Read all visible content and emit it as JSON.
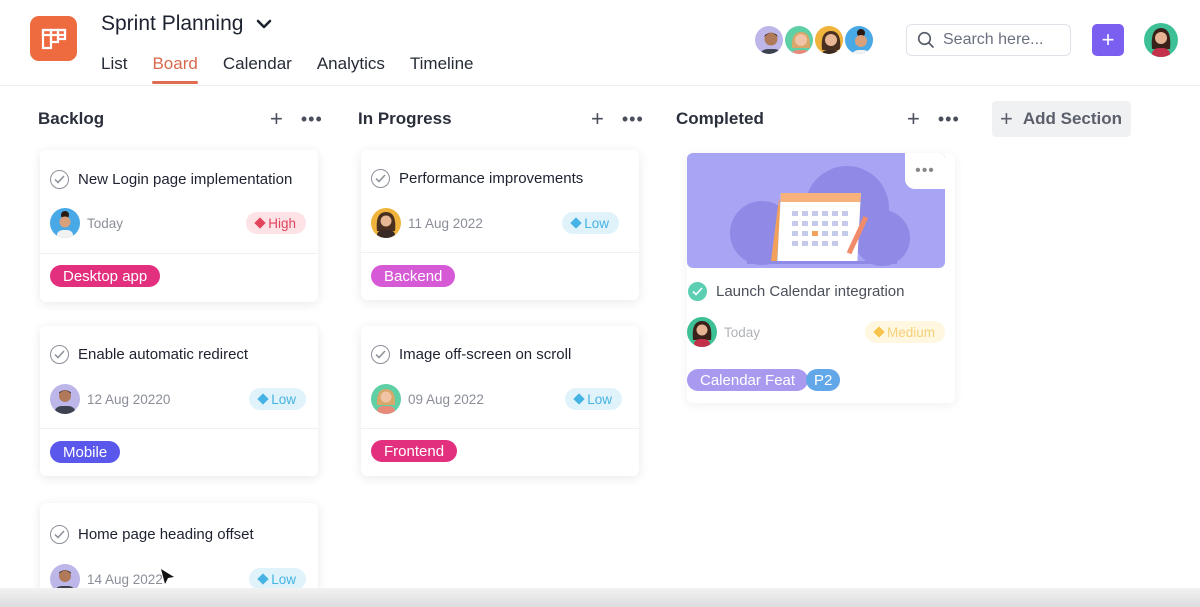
{
  "header": {
    "project_title": "Sprint Planning",
    "tabs": [
      {
        "label": "List",
        "active": false
      },
      {
        "label": "Board",
        "active": true
      },
      {
        "label": "Calendar",
        "active": false
      },
      {
        "label": "Analytics",
        "active": false
      },
      {
        "label": "Timeline",
        "active": false
      }
    ],
    "search": {
      "placeholder": "Search here...",
      "value": ""
    },
    "add_button_label": "+",
    "colors": {
      "accent": "#7a5ff0",
      "logo": "#ee6a3f",
      "active_tab": "#e06c52"
    }
  },
  "columns": [
    {
      "title": "Backlog",
      "cards": [
        {
          "title": "New Login page implementation",
          "date": "Today",
          "priority": "High",
          "tag": "Desktop app",
          "tag_color": "#e2307e",
          "done": false
        },
        {
          "title": "Enable automatic redirect",
          "date": "12 Aug 20220",
          "priority": "Low",
          "tag": "Mobile",
          "tag_color": "#5a57ec",
          "done": false
        },
        {
          "title": "Home page heading offset",
          "date": "14 Aug 2022",
          "priority": "Low",
          "done": false
        }
      ]
    },
    {
      "title": "In Progress",
      "cards": [
        {
          "title": "Performance improvements",
          "date": "11 Aug 2022",
          "priority": "Low",
          "tag": "Backend",
          "tag_color": "#d65ad6",
          "done": false
        },
        {
          "title": "Image off-screen on scroll",
          "date": "09 Aug 2022",
          "priority": "Low",
          "tag": "Frontend",
          "tag_color": "#e2307e",
          "done": false
        }
      ]
    },
    {
      "title": "Completed",
      "cards": [
        {
          "title": "Launch Calendar integration",
          "date": "Today",
          "priority": "Medium",
          "tags": [
            "Calendar Feat",
            "P2"
          ],
          "tag_colors": [
            "#a99af0",
            "#62a8e8"
          ],
          "done": true
        }
      ]
    }
  ],
  "add_section_label": "Add Section",
  "more_label": "•••",
  "plus_label": "+"
}
